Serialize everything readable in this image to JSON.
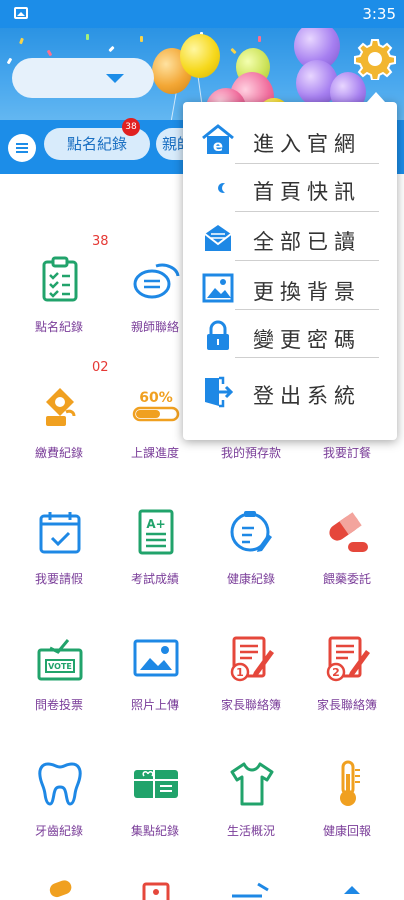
{
  "status_bar": {
    "time": "3:35"
  },
  "tabs": [
    {
      "label": "點名紀錄",
      "badge": "38"
    },
    {
      "label": "親師"
    }
  ],
  "grid": [
    {
      "label": "點名紀錄",
      "badge": "38",
      "icon": "clipboard-check-icon"
    },
    {
      "label": "親師聯絡",
      "badge": "",
      "icon": "chat-bubbles-icon"
    },
    {
      "label": "繳費紀錄",
      "badge": "02",
      "icon": "money-bag-icon"
    },
    {
      "label": "上課進度",
      "badge": "",
      "icon": "progress-bar-icon",
      "progress_text": "60%"
    },
    {
      "label": "我的預存款",
      "badge": "",
      "icon": "wallet-icon"
    },
    {
      "label": "我要訂餐",
      "badge": "",
      "icon": "meal-icon"
    },
    {
      "label": "我要請假",
      "badge": "",
      "icon": "calendar-check-icon"
    },
    {
      "label": "考試成績",
      "badge": "",
      "icon": "grade-paper-icon",
      "grade_text": "A+"
    },
    {
      "label": "健康紀錄",
      "badge": "",
      "icon": "health-clipboard-icon"
    },
    {
      "label": "餵藥委託",
      "badge": "",
      "icon": "pill-capsule-icon"
    },
    {
      "label": "問卷投票",
      "badge": "",
      "icon": "vote-box-icon",
      "vote_text": "VOTE"
    },
    {
      "label": "照片上傳",
      "badge": "",
      "icon": "photo-upload-icon"
    },
    {
      "label": "家長聯絡簿",
      "badge": "",
      "icon": "notebook-one-icon",
      "number": "1"
    },
    {
      "label": "家長聯絡簿",
      "badge": "",
      "icon": "notebook-two-icon",
      "number": "2"
    },
    {
      "label": "牙齒紀錄",
      "badge": "",
      "icon": "tooth-icon"
    },
    {
      "label": "集點紀錄",
      "badge": "",
      "icon": "points-card-icon"
    },
    {
      "label": "生活概況",
      "badge": "",
      "icon": "tshirt-icon"
    },
    {
      "label": "健康回報",
      "badge": "",
      "icon": "thermometer-icon"
    }
  ],
  "dropdown": [
    {
      "label": "進入官網",
      "icon": "website-home-icon"
    },
    {
      "label": "首頁快訊",
      "icon": "news-dot-icon"
    },
    {
      "label": "全部已讀",
      "icon": "mail-read-icon"
    },
    {
      "label": "更換背景",
      "icon": "change-background-icon"
    },
    {
      "label": "變更密碼",
      "icon": "lock-icon"
    },
    {
      "label": "登出系統",
      "icon": "logout-door-icon"
    }
  ],
  "colors": {
    "primary_blue": "#1c8de8",
    "label_purple": "#7a3d99",
    "badge_red": "#e53935",
    "icon_green": "#21a36b",
    "icon_blue": "#1e88e5",
    "icon_red": "#e5473b",
    "icon_orange": "#f0a020"
  }
}
